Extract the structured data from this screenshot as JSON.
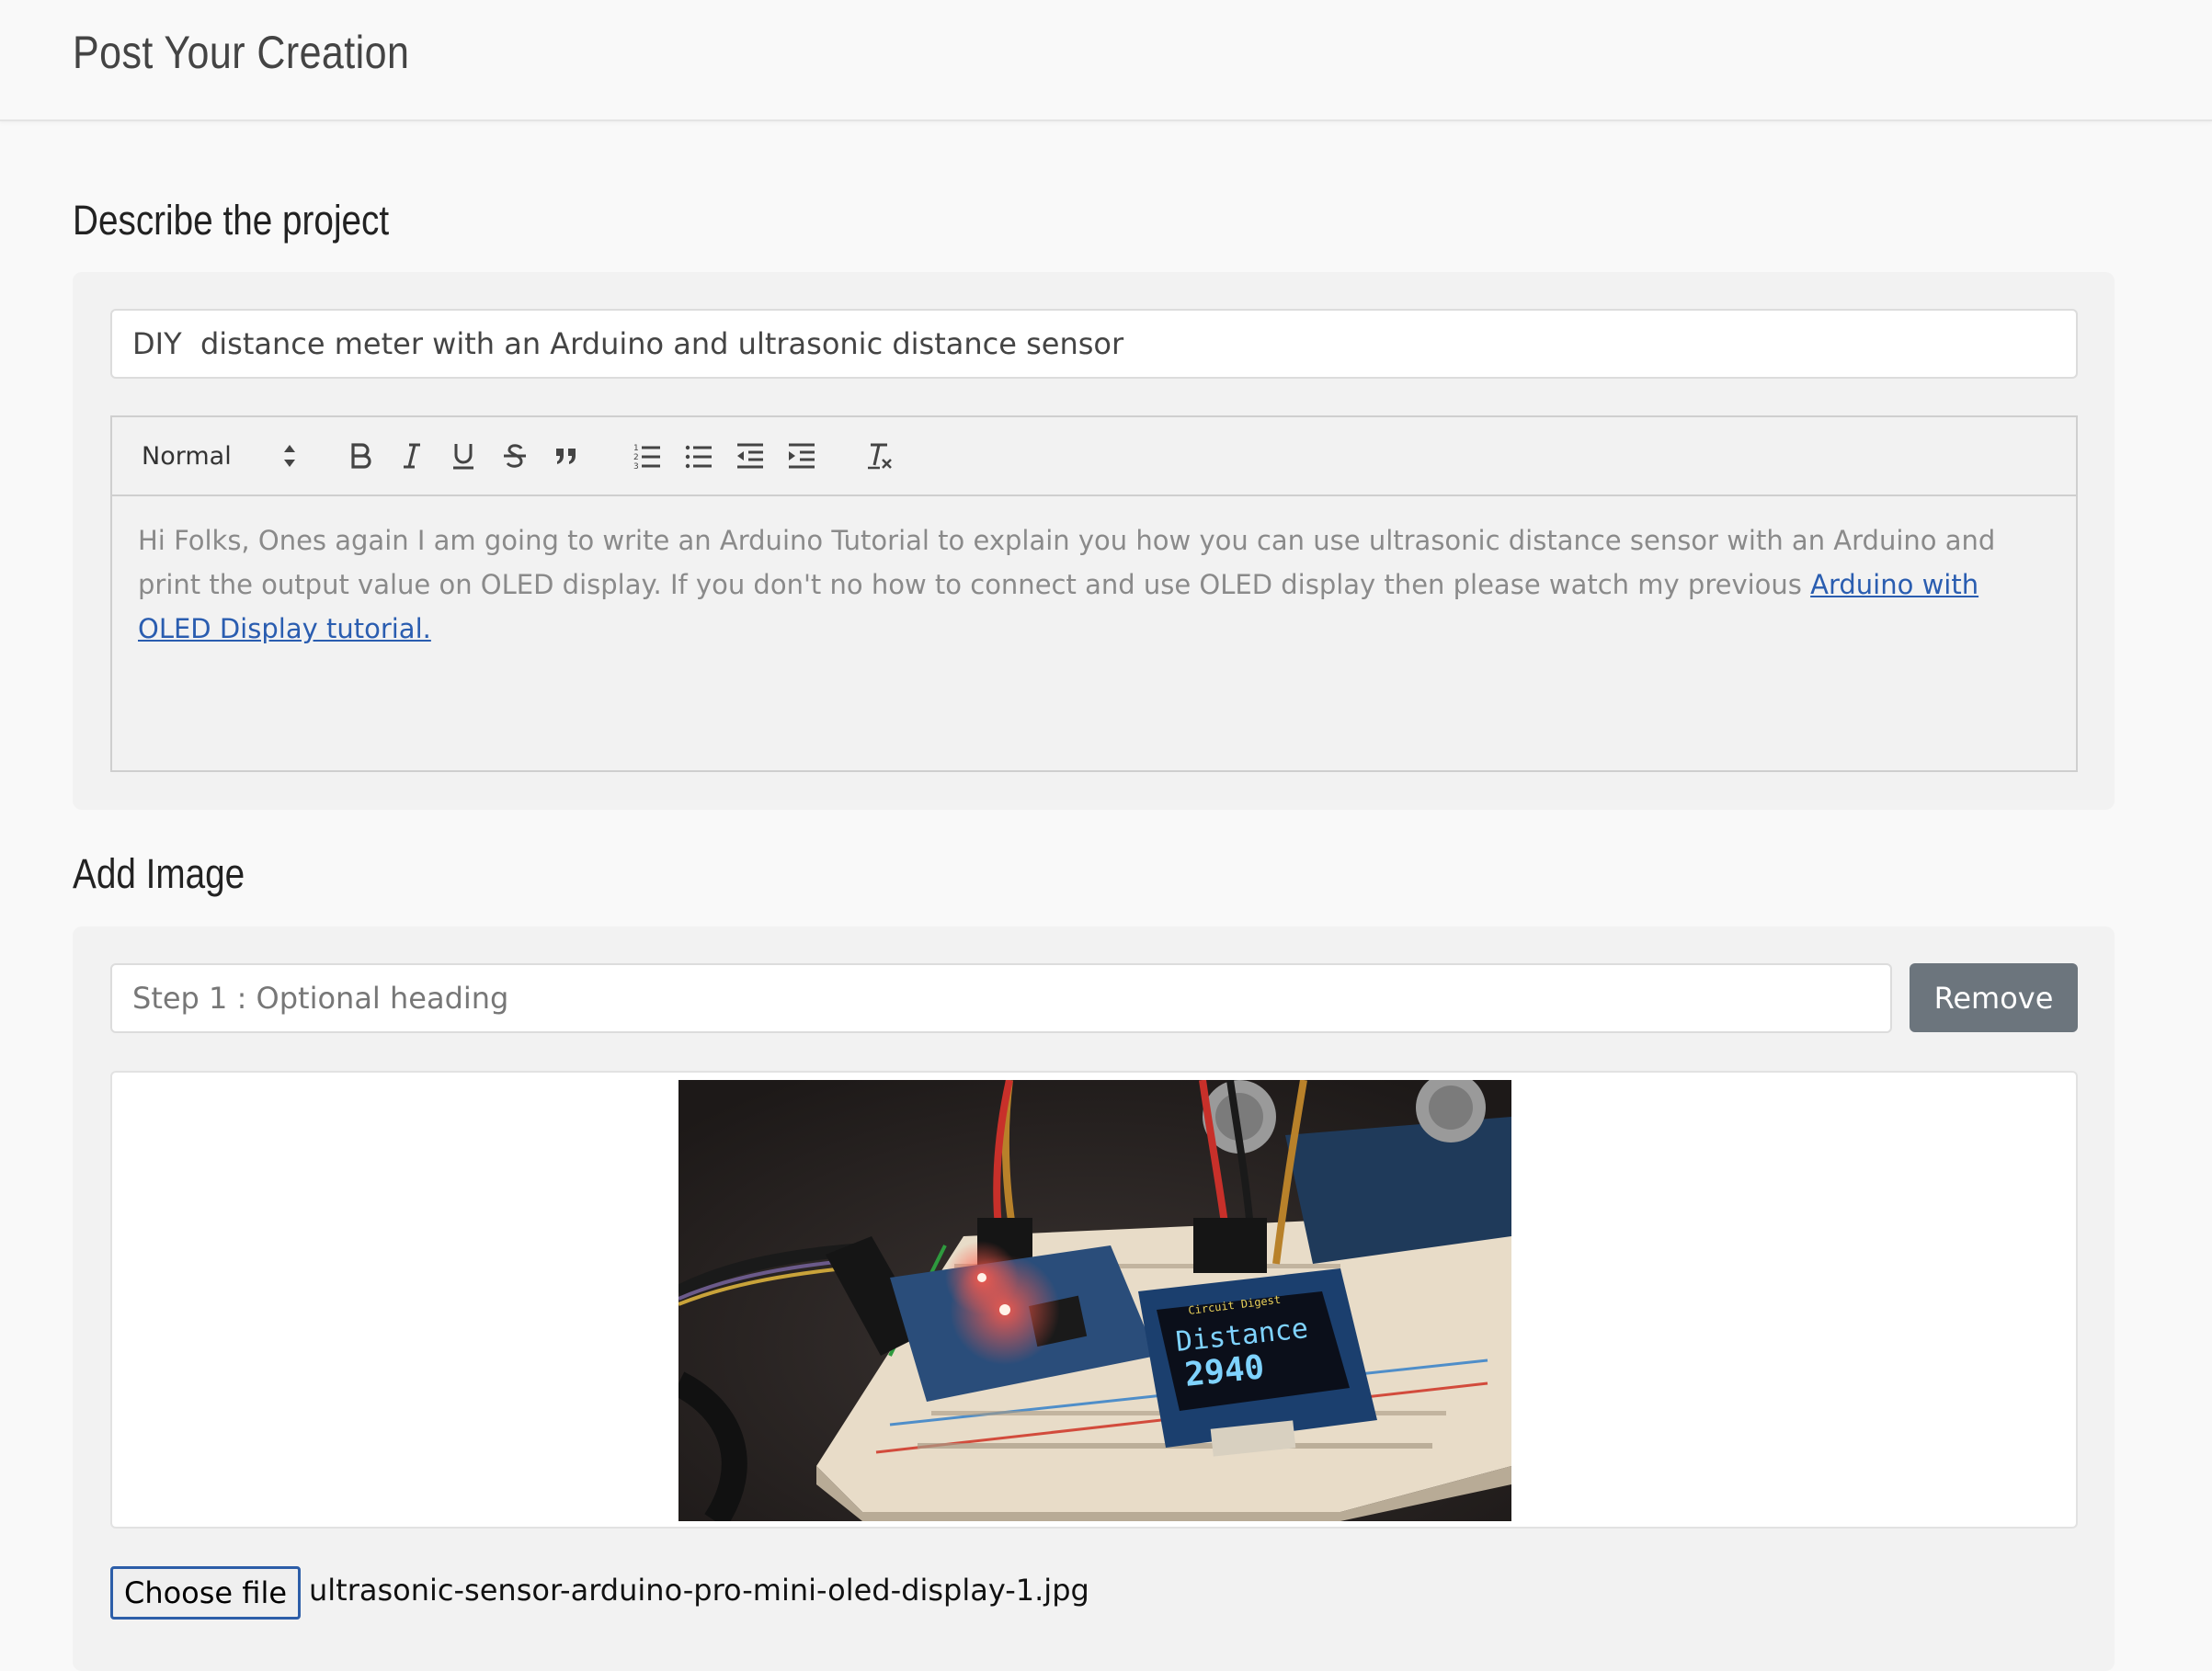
{
  "header": {
    "title": "Post Your Creation"
  },
  "describe": {
    "section_title": "Describe the project",
    "title_input_value": "DIY  distance meter with an Arduino and ultrasonic distance sensor",
    "editor": {
      "format_select_value": "Normal",
      "toolbar_icons": [
        "bold-icon",
        "italic-icon",
        "underline-icon",
        "strikethrough-icon",
        "blockquote-icon",
        "ordered-list-icon",
        "bullet-list-icon",
        "outdent-icon",
        "indent-icon",
        "clear-format-icon"
      ],
      "body_text": "Hi Folks, Ones again I am going to write an Arduino Tutorial to explain you how you can use ultrasonic distance sensor with an Arduino and print the output value on OLED display. If you don't no how to connect and use OLED display then please watch my previous ",
      "link_text": "Arduino with OLED Display tutorial."
    }
  },
  "add_image": {
    "section_title": "Add Image",
    "heading_placeholder": "Step 1 : Optional heading",
    "remove_label": "Remove",
    "oled_line1": "Distance",
    "oled_line2": "2940",
    "oled_header": "Circuit Digest",
    "choose_file_label": "Choose file",
    "file_name": "ultrasonic-sensor-arduino-pro-mini-oled-display-1.jpg"
  },
  "colors": {
    "accent_button": "#6c757d",
    "link": "#2a5db0",
    "file_button_border": "#2d5ea8"
  }
}
